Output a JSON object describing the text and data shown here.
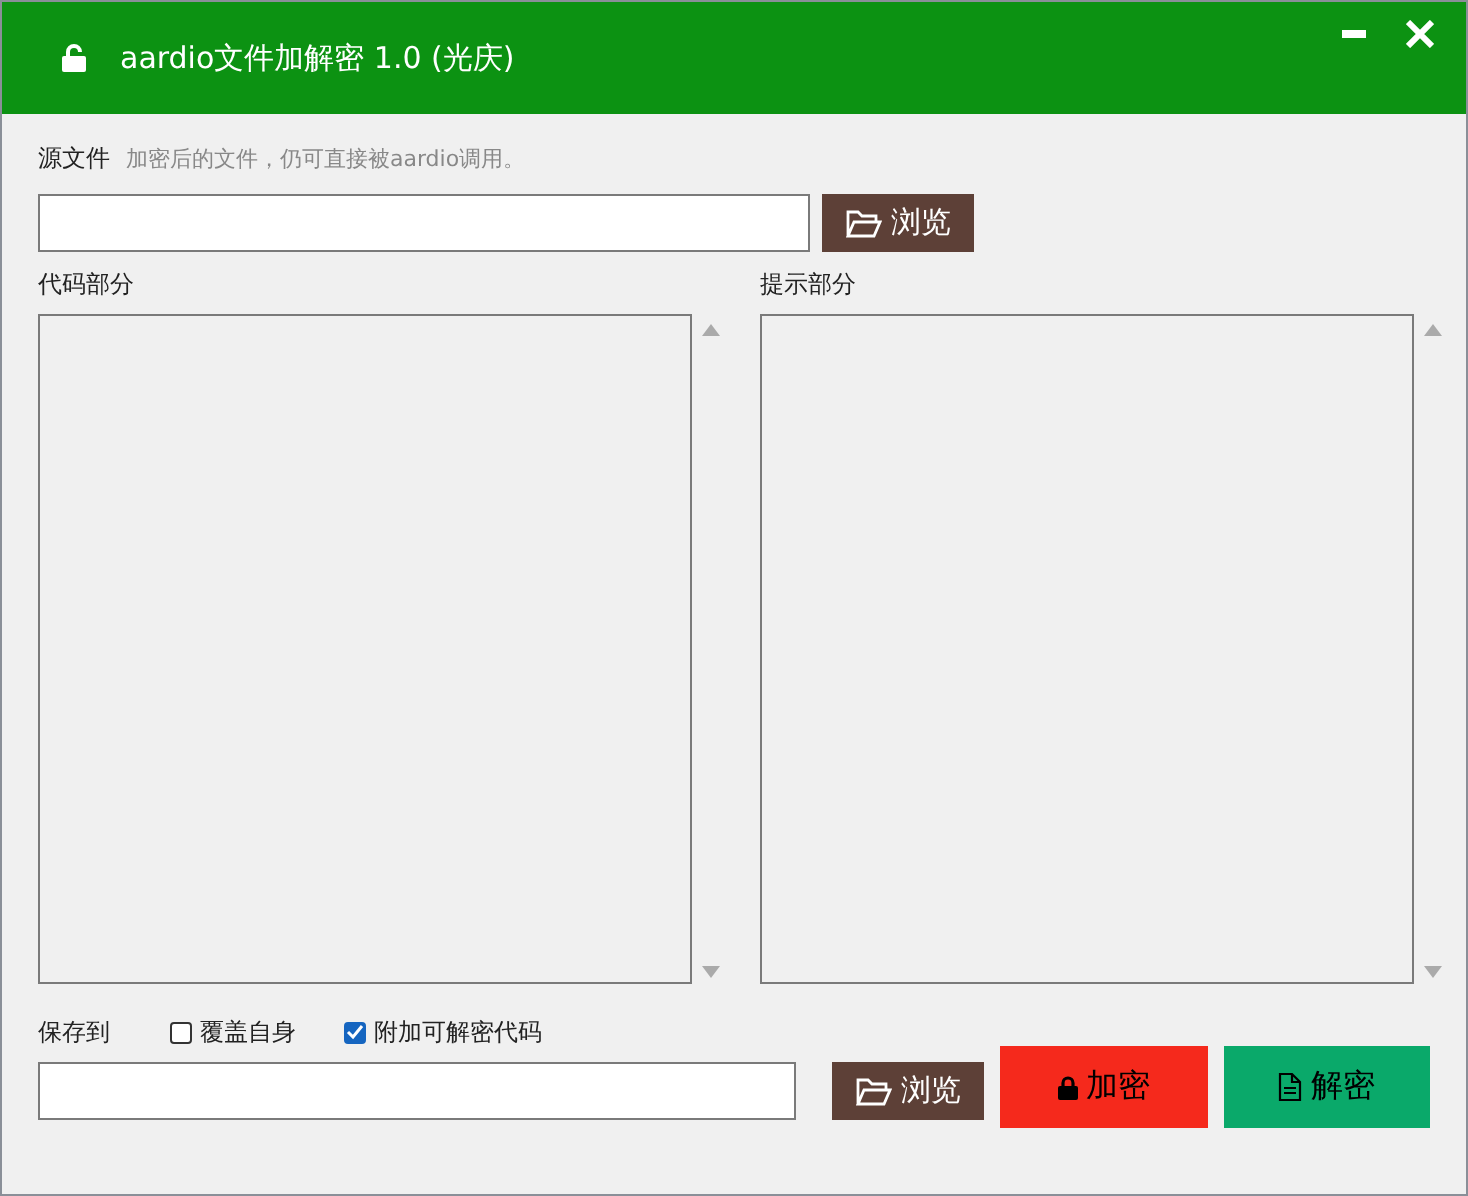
{
  "window": {
    "title": "aardio文件加解密 1.0 (光庆)"
  },
  "source": {
    "label": "源文件",
    "hint": "加密后的文件，仍可直接被aardio调用。",
    "browse": "浏览"
  },
  "panes": [
    {
      "label": "代码部分"
    },
    {
      "label": "提示部分"
    }
  ],
  "save": {
    "label": "保存到",
    "options": [
      {
        "label": "覆盖自身",
        "checked": false
      },
      {
        "label": "附加可解密代码",
        "checked": true
      }
    ],
    "browse": "浏览"
  },
  "buttons": [
    {
      "kind": "encrypt",
      "label": "加密"
    },
    {
      "kind": "decrypt",
      "label": "解密"
    }
  ]
}
